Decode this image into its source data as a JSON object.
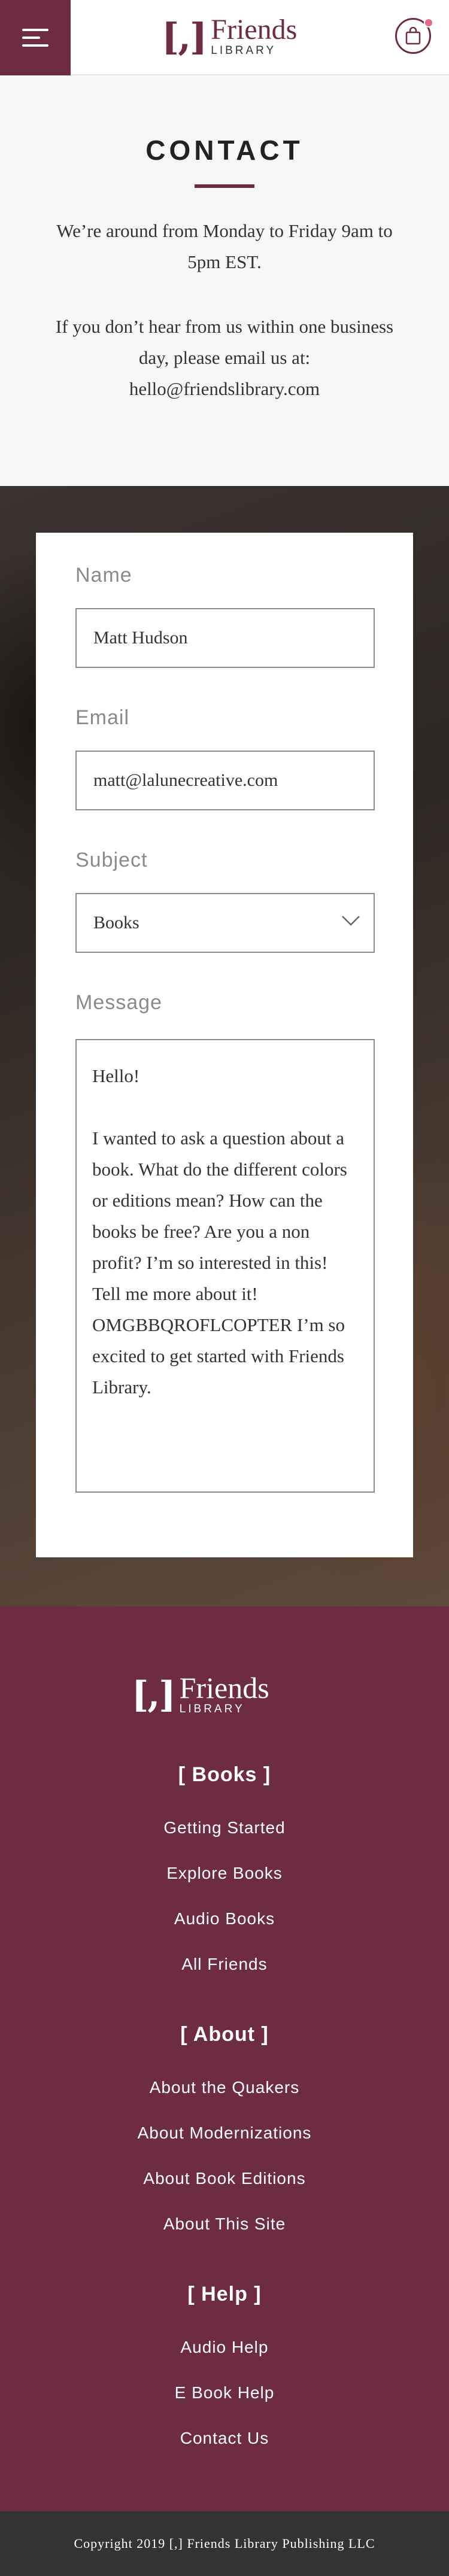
{
  "header": {
    "logo_mark": "[,]",
    "logo_word1": "Friends",
    "logo_word2": "LIBRARY",
    "menu_icon": "hamburger-menu-icon",
    "cart_icon": "shopping-bag-icon",
    "accent_color": "#6e2c41",
    "badge_color": "#e86a8a"
  },
  "intro": {
    "title": "CONTACT",
    "hours": "We’re around from Monday to Friday 9am to 5pm EST.",
    "email_note": "If you don’t hear from us within one business day, please email us at: hello@friendslibrary.com"
  },
  "form": {
    "name_label": "Name",
    "name_value": "Matt Hudson",
    "email_label": "Email",
    "email_value": "matt@lalunecreative.com",
    "subject_label": "Subject",
    "subject_value": "Books",
    "message_label": "Message",
    "message_value": "Hello!\n\nI wanted to ask a question about a book. What do the different colors or editions mean? How can the books be free? Are you a non profit? I’m so interested in this! Tell me more about it! OMGBBQROFLCOPTER I’m so excited to get started with Friends Library."
  },
  "footer": {
    "logo_mark": "[,]",
    "logo_word1": "Friends",
    "logo_word2": "LIBRARY",
    "sections": [
      {
        "heading": "[ Books ]",
        "links": [
          "Getting Started",
          "Explore Books",
          "Audio Books",
          "All Friends"
        ]
      },
      {
        "heading": "[ About ]",
        "links": [
          "About the Quakers",
          "About Modernizations",
          "About Book Editions",
          "About This Site"
        ]
      },
      {
        "heading": "[ Help ]",
        "links": [
          "Audio Help",
          "E Book Help",
          "Contact Us"
        ]
      }
    ],
    "copyright": "Copyright 2019 [,] Friends Library Publishing LLC"
  }
}
